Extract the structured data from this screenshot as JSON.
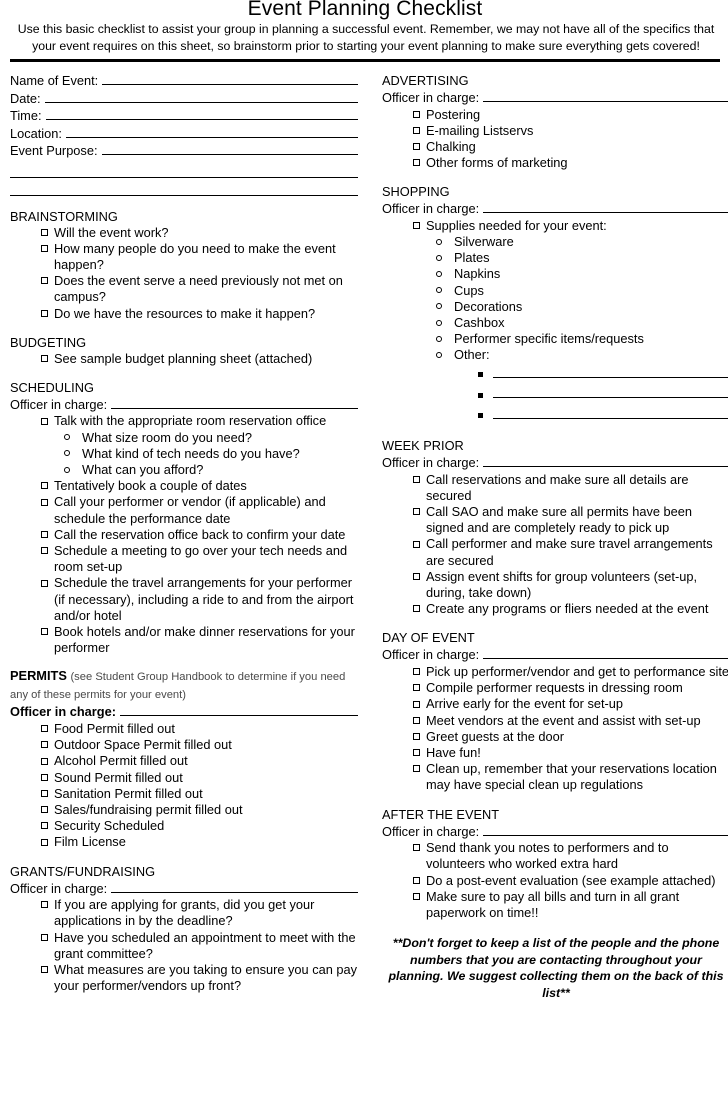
{
  "document": {
    "title": "Event Planning Checklist",
    "intro": "Use this basic checklist to assist your group in planning a successful event.  Remember, we may not have all of the specifics that your event requires on this sheet, so brainstorm prior to starting your event planning to make sure everything gets covered!",
    "officer_label": "Officer in charge:",
    "footer_note": "**Don't forget to keep a list of the people and the phone numbers that you are contacting throughout your planning.  We suggest collecting them on the back of this list**"
  },
  "event_fields": [
    {
      "label": "Name of Event:"
    },
    {
      "label": "Date:"
    },
    {
      "label": "Time:"
    },
    {
      "label": "Location:"
    },
    {
      "label": "Event Purpose:"
    }
  ],
  "left": {
    "brainstorming": {
      "heading": "BRAINSTORMING",
      "items": [
        "Will the event work?",
        "How many people do you need to make the event happen?",
        "Does the event serve a need previously not met on campus?",
        "Do we have the resources to make it happen?"
      ]
    },
    "budgeting": {
      "heading": "BUDGETING",
      "items": [
        "See sample budget planning sheet (attached)"
      ]
    },
    "scheduling": {
      "heading": "SCHEDULING",
      "items": [
        "Talk with the appropriate room reservation office",
        "Tentatively book a couple of dates",
        "Call your performer or vendor (if applicable) and schedule the performance date",
        "Call the reservation office back to confirm your date",
        "Schedule a meeting to go over your tech needs and room set-up",
        "Schedule the travel arrangements for your performer (if necessary), including a ride to and from the airport and/or hotel",
        "Book hotels and/or make dinner reservations for your performer"
      ],
      "subitems": [
        "What size room do you need?",
        "What kind of tech needs do you have?",
        "What can you afford?"
      ]
    },
    "permits": {
      "heading": "PERMITS",
      "heading_note": "(see Student Group Handbook to determine if you need any of these permits for your event)",
      "items": [
        "Food Permit filled out",
        "Outdoor Space Permit filled out",
        "Alcohol Permit filled out",
        "Sound Permit filled out",
        "Sanitation Permit filled out",
        "Sales/fundraising permit filled out",
        "Security Scheduled",
        "Film License"
      ]
    },
    "grants": {
      "heading": "GRANTS/FUNDRAISING",
      "items": [
        "If you are applying for grants, did you get your applications in by the deadline?",
        "Have you scheduled an appointment to meet with the grant committee?",
        "What measures are you taking to ensure you can pay your performer/vendors up front?"
      ]
    }
  },
  "right": {
    "advertising": {
      "heading": "ADVERTISING",
      "items": [
        "Postering",
        "E-mailing Listservs",
        "Chalking",
        "Other forms of marketing"
      ]
    },
    "shopping": {
      "heading": "SHOPPING",
      "items": [
        "Supplies needed for your event:"
      ],
      "subitems": [
        "Silverware",
        "Plates",
        "Napkins",
        "Cups",
        "Decorations",
        "Cashbox",
        "Performer specific items/requests",
        "Other:"
      ],
      "other_blank_count": 3
    },
    "week_prior": {
      "heading": "WEEK PRIOR",
      "items": [
        "Call reservations and make sure all details are secured",
        "Call SAO and make sure all permits have been signed and are completely ready to pick up",
        "Call performer and make sure travel arrangements are secured",
        "Assign event shifts for group volunteers (set-up, during, take down)",
        "Create any programs or fliers needed at the event"
      ]
    },
    "day_of_event": {
      "heading": "DAY OF EVENT",
      "items": [
        "Pick up performer/vendor and get to performance site",
        "Compile performer requests in dressing room",
        "Arrive early for the event for set-up",
        "Meet vendors at the event and assist with set-up",
        "Greet guests at the door",
        "Have fun!",
        "Clean up, remember that your reservations location may have special clean up regulations"
      ]
    },
    "after_the_event": {
      "heading": "AFTER THE EVENT",
      "items": [
        "Send thank you notes to performers and to volunteers who worked extra hard",
        "Do a post-event evaluation (see example attached)",
        "Make sure to pay all bills and turn in all grant paperwork on time!!"
      ]
    }
  }
}
